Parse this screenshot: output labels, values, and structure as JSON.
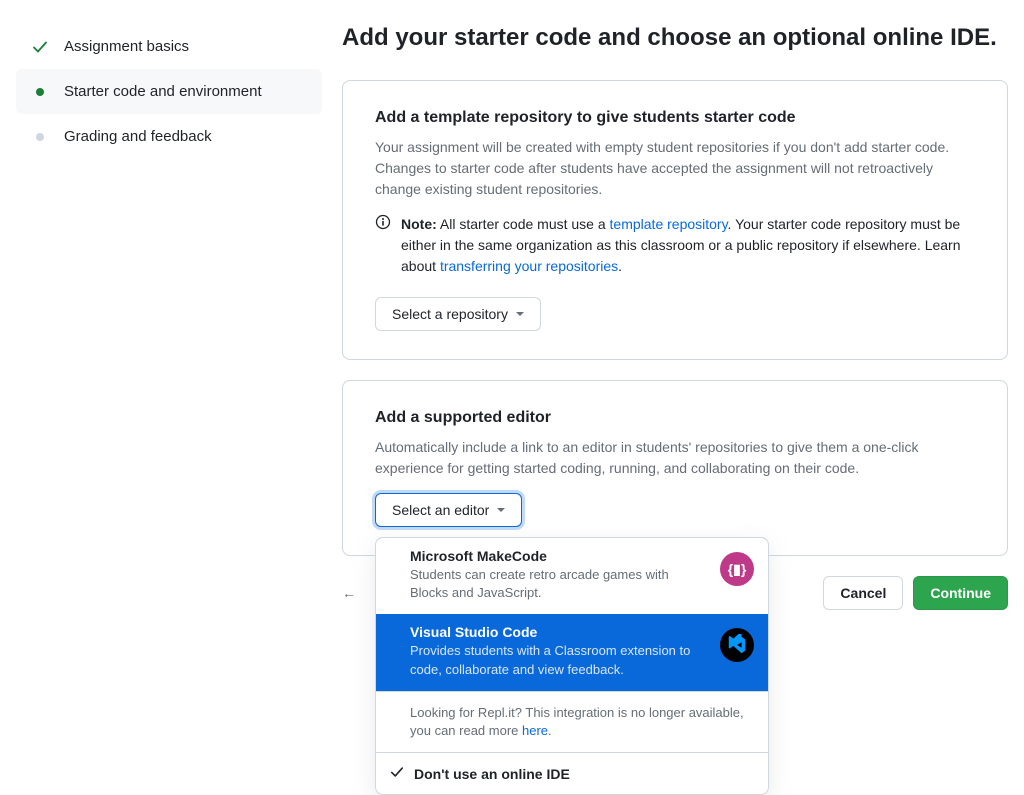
{
  "sidebar": {
    "items": [
      {
        "label": "Assignment basics",
        "state": "done"
      },
      {
        "label": "Starter code and environment",
        "state": "active"
      },
      {
        "label": "Grading and feedback",
        "state": "pending"
      }
    ]
  },
  "page": {
    "title": "Add your starter code and choose an optional online IDE."
  },
  "templatePanel": {
    "title": "Add a template repository to give students starter code",
    "desc": "Your assignment will be created with empty student repositories if you don't add starter code. Changes to starter code after students have accepted the assignment will not retroactively change existing student repositories.",
    "notePrefix": "Note:",
    "noteBeforeLink1": " All starter code must use a ",
    "noteLink1": "template repository",
    "noteMiddle": ". Your starter code repository must be either in the same organization as this classroom or a public repository if elsewhere. Learn about ",
    "noteLink2": "transferring your repositories",
    "noteEnd": ".",
    "dropdownLabel": "Select a repository"
  },
  "editorPanel": {
    "title": "Add a supported editor",
    "desc": "Automatically include a link to an editor in students' repositories to give them a one-click experience for getting started coding, running, and collaborating on their code.",
    "dropdownLabel": "Select an editor"
  },
  "editorDropdown": {
    "options": [
      {
        "title": "Microsoft MakeCode",
        "desc": "Students can create retro arcade games with Blocks and JavaScript.",
        "iconBg": "#bf3989"
      },
      {
        "title": "Visual Studio Code",
        "desc": "Provides students with a Classroom extension to code, collaborate and view feedback.",
        "iconBg": "#000000"
      }
    ],
    "replitNoteBefore": "Looking for Repl.it? This integration is no longer available, you can read more ",
    "replitLink": "here",
    "replitNoteAfter": ".",
    "noIdeLabel": "Don't use an online IDE"
  },
  "footer": {
    "backArrow": "←",
    "cancel": "Cancel",
    "continue": "Continue"
  }
}
